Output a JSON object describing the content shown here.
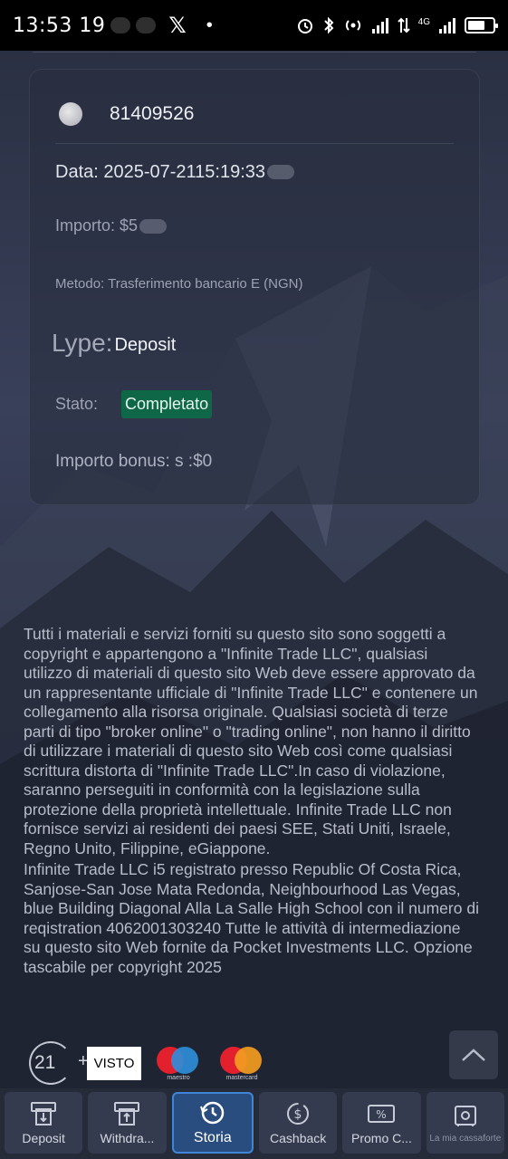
{
  "status_bar": {
    "time": "13:53 19",
    "network_label": "4G"
  },
  "transaction": {
    "id": "81409526",
    "date": "Data: 2025-07-2115:19:33",
    "amount": "Importo: $5",
    "method": "Metodo: Trasferimento bancario E (NGN)",
    "type_label": "Lype:",
    "type_value": "Deposit",
    "status_label": "Stato:",
    "status_value": "Completato",
    "bonus": "Importo bonus: s :$0"
  },
  "disclaimer": {
    "paragraph1": "Tutti i materiali e servizi forniti su questo sito sono soggetti a copyright e appartengono a \"Infinite Trade LLC\", qualsiasi utilizzo di materiali di questo sito Web deve essere approvato da un rappresentante ufficiale di \"Infinite Trade LLC\" e contenere un collegamento alla risorsa originale. Qualsiasi società di terze parti di tipo \"broker online\" o \"trading online\", non hanno il diritto di utilizzare i materiali di questo sito Web così come qualsiasi scrittura distorta di \"Infinite Trade LLC\".In caso di violazione, saranno perseguiti in conformità con la legislazione sulla protezione della proprietà intellettuale. Infinite Trade LLC non fornisce servizi ai residenti dei paesi SEE, Stati Uniti, Israele, Regno Unito, Filippine, eGiappone.",
    "paragraph2": "Infinite Trade LLC i5 registrato presso Republic Of Costa Rica, Sanjose-San Jose Mata Redonda, Neighbourhood Las Vegas, blue Building Diagonal Alla La Salle High School con il numero di reqistration 4062001303240 Tutte le attività di intermediazione su questo sito Web fornite da Pocket Investments LLC. Opzione tascabile per copyright 2025"
  },
  "payment": {
    "age_text": "21",
    "age_plus": "+",
    "visa_label": "VISTO",
    "maestro_caption": "maestro",
    "mastercard_caption": "mastercard"
  },
  "nav": {
    "items": [
      {
        "label": "Deposit",
        "icon": "atm-deposit-icon"
      },
      {
        "label": "Withdra...",
        "icon": "atm-withdraw-icon"
      },
      {
        "label": "Storia",
        "icon": "history-clock-icon"
      },
      {
        "label": "Cashback",
        "icon": "cashback-icon"
      },
      {
        "label": "Promo C...",
        "icon": "promo-coupon-icon"
      },
      {
        "label": "La mia cassaforte",
        "icon": "safe-icon"
      }
    ],
    "active_index": 2
  },
  "colors": {
    "status_badge": "#0e6848",
    "active_tab_border": "#3f86d9",
    "active_tab_bg": "#2a4d80"
  }
}
